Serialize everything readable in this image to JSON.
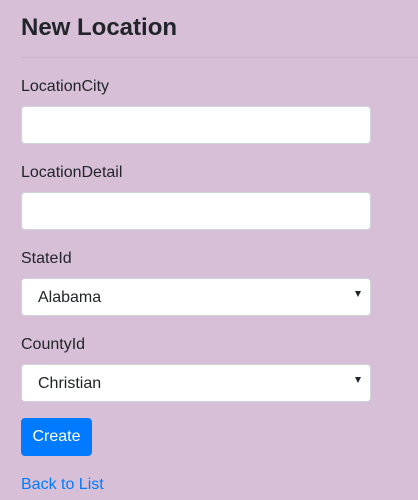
{
  "page": {
    "title": "New Location"
  },
  "form": {
    "location_city": {
      "label": "LocationCity",
      "value": "",
      "placeholder": ""
    },
    "location_detail": {
      "label": "LocationDetail",
      "value": "",
      "placeholder": ""
    },
    "state_id": {
      "label": "StateId",
      "selected": "Alabama"
    },
    "county_id": {
      "label": "CountyId",
      "selected": "Christian"
    },
    "create_label": "Create"
  },
  "footer": {
    "back_link_label": "Back to List"
  },
  "icons": {
    "select_arrow": "chevron-down-icon"
  },
  "colors": {
    "page_background": "#d8bfd8",
    "primary": "#007bff",
    "text": "#212529"
  }
}
